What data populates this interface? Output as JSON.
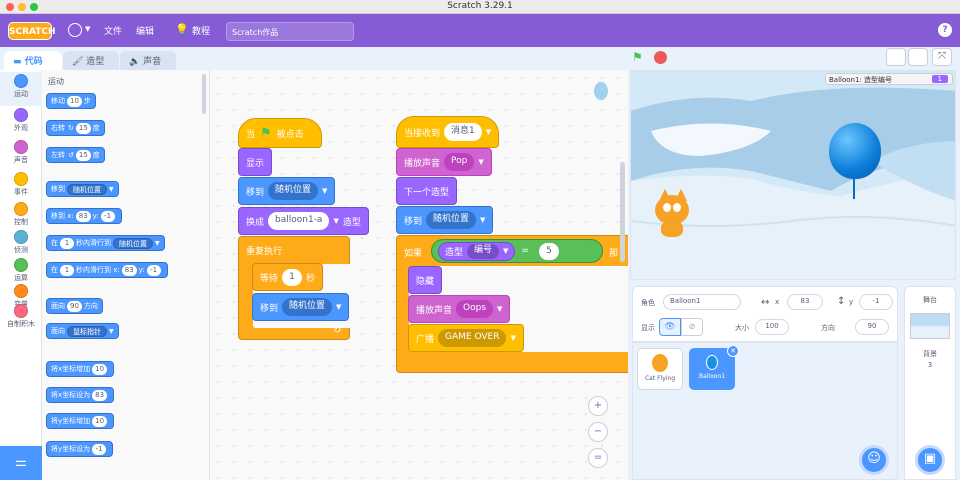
{
  "window": {
    "title": "Scratch 3.29.1"
  },
  "menubar": {
    "logo": "SCRATCH",
    "file": "文件",
    "edit": "编辑",
    "tutorials": "教程",
    "project_title": "Scratch作品",
    "help": "?"
  },
  "tabs": {
    "code": "代码",
    "costumes": "造型",
    "sounds": "声音"
  },
  "categories": [
    {
      "label": "运动",
      "color": "#4c97ff"
    },
    {
      "label": "外观",
      "color": "#9966ff"
    },
    {
      "label": "声音",
      "color": "#cf63cf"
    },
    {
      "label": "事件",
      "color": "#ffbf00"
    },
    {
      "label": "控制",
      "color": "#ffab19"
    },
    {
      "label": "侦测",
      "color": "#5cb1d6"
    },
    {
      "label": "运算",
      "color": "#59c059"
    },
    {
      "label": "变量",
      "color": "#ff8c1a"
    },
    {
      "label": "自制积木",
      "color": "#ff6680"
    }
  ],
  "palette": {
    "title": "运动",
    "move": {
      "a": "移动",
      "n": "10",
      "b": "步"
    },
    "turn_right": {
      "a": "右转",
      "icon": "↻",
      "n": "15",
      "b": "度"
    },
    "turn_left": {
      "a": "左转",
      "icon": "↺",
      "n": "15",
      "b": "度"
    },
    "goto": {
      "a": "移到",
      "dd": "随机位置"
    },
    "goto_xy": {
      "a": "移到 x:",
      "x": "83",
      "b": "y:",
      "y": "-1"
    },
    "glide": {
      "a": "在",
      "n": "1",
      "b": "秒内滑行到",
      "dd": "随机位置"
    },
    "glide_xy": {
      "a": "在",
      "n": "1",
      "b": "秒内滑行到 x:",
      "x": "83",
      "c": "y:",
      "y": "-1"
    },
    "point": {
      "a": "面向",
      "n": "90",
      "b": "方向"
    },
    "point_towards": {
      "a": "面向",
      "dd": "鼠标指针"
    },
    "change_x": {
      "a": "将x坐标增加",
      "n": "10"
    },
    "set_x": {
      "a": "将x坐标设为",
      "n": "83"
    },
    "change_y": {
      "a": "将y坐标增加",
      "n": "10"
    },
    "set_y": {
      "a": "将y坐标设为",
      "n": "-1"
    }
  },
  "script1": {
    "when_flag": {
      "a": "当",
      "b": "被点击"
    },
    "show": "显示",
    "goto": {
      "a": "移到",
      "dd": "随机位置"
    },
    "switch": {
      "a": "换成",
      "dd": "balloon1-a",
      "b": "造型"
    },
    "forever": "重复执行",
    "wait": {
      "a": "等待",
      "n": "1",
      "b": "秒"
    },
    "goto2": {
      "a": "移到",
      "dd": "随机位置"
    }
  },
  "script2": {
    "when_receive": {
      "a": "当接收到",
      "dd": "消息1"
    },
    "play_sound": {
      "a": "播放声音",
      "dd": "Pop"
    },
    "next_costume": "下一个造型",
    "goto": {
      "a": "移到",
      "dd": "随机位置"
    },
    "if": {
      "a": "如果",
      "costume": "造型",
      "dd": "编号",
      "eq": "=",
      "n": "5",
      "then": "那"
    },
    "hide": "隐藏",
    "play_sound2": {
      "a": "播放声音",
      "dd": "Oops"
    },
    "broadcast": {
      "a": "广播",
      "dd": "GAME OVER"
    }
  },
  "zoom": {
    "in": "+",
    "out": "−",
    "reset": "="
  },
  "stage_monitor": {
    "label": "Balloon1: 造型编号",
    "value": "1"
  },
  "sprite_info": {
    "sprite_label": "角色",
    "sprite_name": "Balloon1",
    "x_label": "x",
    "x": "83",
    "y_label": "y",
    "y": "-1",
    "show_label": "显示",
    "size_label": "大小",
    "size": "100",
    "direction_label": "方向",
    "direction": "90"
  },
  "sprites": [
    {
      "name": "Cat Flying"
    },
    {
      "name": "Balloon1"
    }
  ],
  "stage_panel": {
    "title": "舞台",
    "backdrops_label": "背景",
    "backdrops_count": "3"
  },
  "colors": {
    "accent": "#855cd6",
    "motion": "#4c97ff"
  }
}
